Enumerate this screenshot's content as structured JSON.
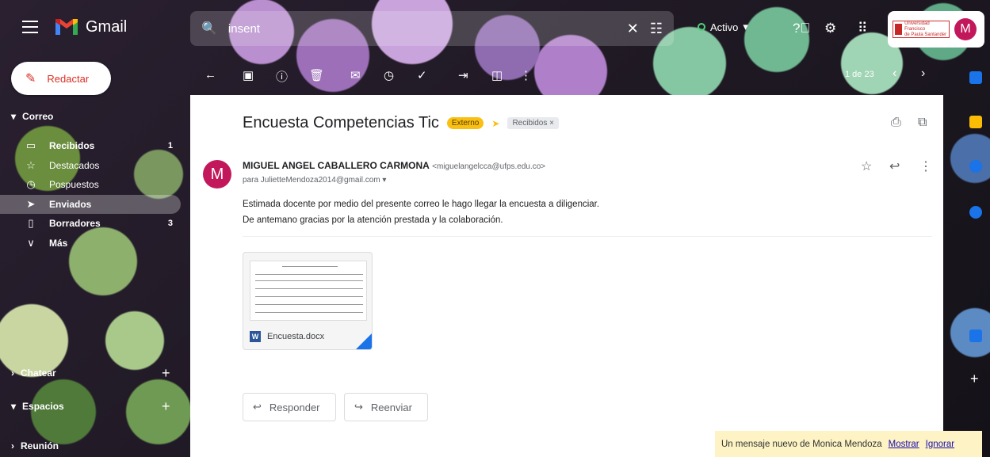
{
  "app": {
    "name": "Gmail"
  },
  "search": {
    "value": "insent"
  },
  "status": {
    "label": "Activo"
  },
  "org": {
    "name_line1": "Universidad Francisco",
    "name_line2": "de Paula Santander"
  },
  "user": {
    "initial": "M"
  },
  "compose": {
    "label": "Redactar"
  },
  "sidebar": {
    "mail_section": "Correo",
    "items": [
      {
        "label": "Recibidos",
        "count": "1",
        "icon": "inbox-icon"
      },
      {
        "label": "Destacados",
        "count": "",
        "icon": "star-icon"
      },
      {
        "label": "Pospuestos",
        "count": "",
        "icon": "clock-icon"
      },
      {
        "label": "Enviados",
        "count": "",
        "icon": "send-icon"
      },
      {
        "label": "Borradores",
        "count": "3",
        "icon": "draft-icon"
      },
      {
        "label": "Más",
        "count": "",
        "icon": "chevron-down-icon"
      }
    ],
    "chat_section": "Chatear",
    "spaces_section": "Espacios",
    "meet_section": "Reunión"
  },
  "pager": {
    "text": "1 de 23"
  },
  "message": {
    "subject": "Encuesta Competencias Tic",
    "external_badge": "Externo",
    "label_badge": "Recibidos ×",
    "sender_initial": "M",
    "sender_name": "MIGUEL ANGEL CABALLERO CARMONA",
    "sender_email": "<miguelangelcca@ufps.edu.co>",
    "to": "para JulietteMendoza2014@gmail.com",
    "body_line1": "Estimada docente por medio del presente correo le hago llegar la encuesta a diligenciar.",
    "body_line2": "De antemano gracias por la atención prestada y la colaboración.",
    "attachment_name": "Encuesta.docx",
    "attachment_type_letter": "W"
  },
  "actions": {
    "reply": "Responder",
    "forward": "Reenviar"
  },
  "toast": {
    "text": "Un mensaje nuevo de Monica Mendoza",
    "show": "Mostrar",
    "ignore": "Ignorar"
  },
  "colors": {
    "accent_red": "#d93025",
    "avatar": "#c2185b",
    "external_badge": "#f9c013",
    "toast_bg": "#fdf3c4"
  }
}
